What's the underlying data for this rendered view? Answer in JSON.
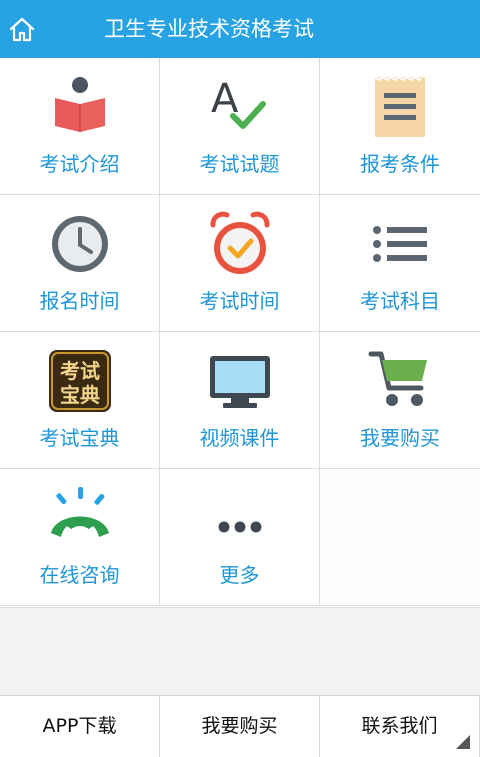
{
  "header": {
    "title": "卫生专业技术资格考试",
    "home_icon": "home-icon"
  },
  "grid": {
    "items": [
      {
        "label": "考试介绍",
        "icon": "reading-person-icon"
      },
      {
        "label": "考试试题",
        "icon": "letter-a-check-icon"
      },
      {
        "label": "报考条件",
        "icon": "document-list-icon"
      },
      {
        "label": "报名时间",
        "icon": "clock-icon"
      },
      {
        "label": "考试时间",
        "icon": "alarm-clock-icon"
      },
      {
        "label": "考试科目",
        "icon": "bullet-list-icon"
      },
      {
        "label": "考试宝典",
        "icon": "book-badge-icon",
        "badge_text": "考试宝典"
      },
      {
        "label": "视频课件",
        "icon": "monitor-icon"
      },
      {
        "label": "我要购买",
        "icon": "shopping-cart-icon"
      },
      {
        "label": "在线咨询",
        "icon": "phone-ringing-icon"
      },
      {
        "label": "更多",
        "icon": "more-dots-icon"
      }
    ]
  },
  "footer": {
    "download_label": "APP下载",
    "buy_label": "我要购买",
    "contact_label": "联系我们"
  },
  "colors": {
    "header_bg": "#27a3e3",
    "label": "#2096d6",
    "check_green": "#4caf50",
    "alarm_red": "#e8533f"
  }
}
